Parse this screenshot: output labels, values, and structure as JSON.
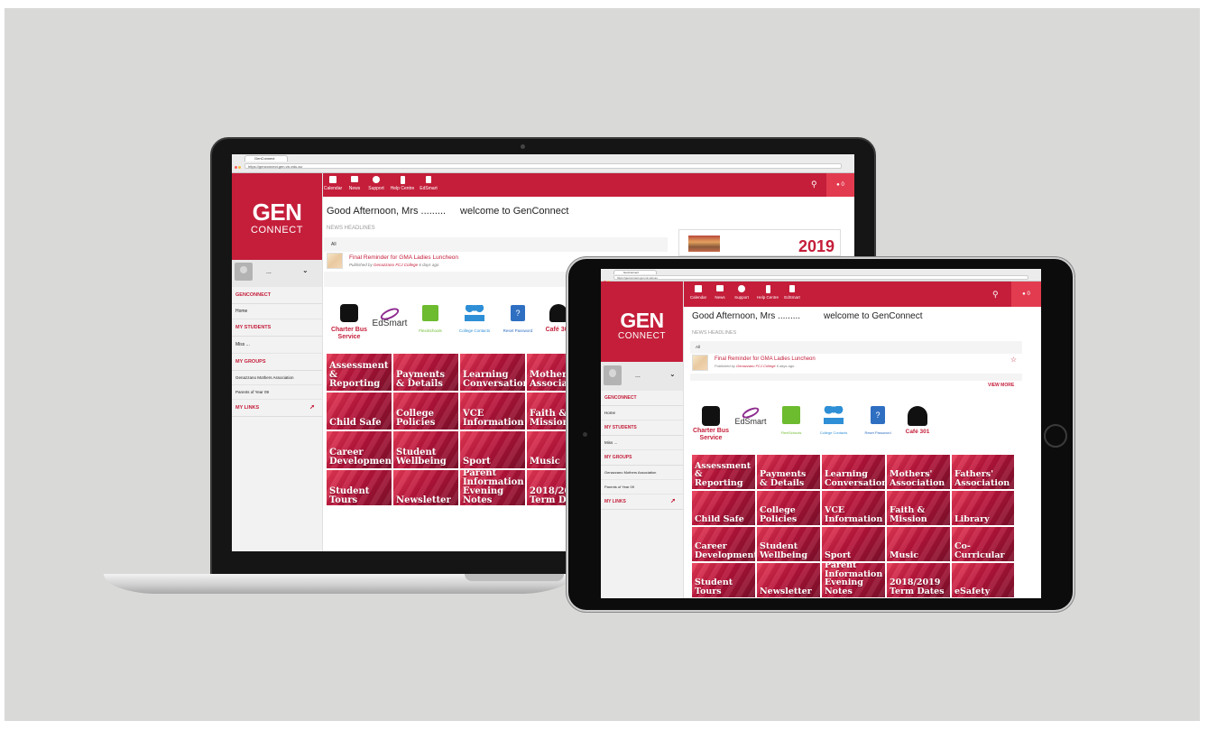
{
  "browser": {
    "tab_title": "GenConnect",
    "laptop_url": "https://genconnect.gen.vic.edu.au",
    "tablet_url": "https://genconnect.gen.vic.edu.au"
  },
  "topnav": {
    "items": [
      {
        "label": "Calendar",
        "icon": "calendar-icon"
      },
      {
        "label": "News",
        "icon": "news-icon"
      },
      {
        "label": "Support",
        "icon": "help-icon"
      },
      {
        "label": "Help Centre",
        "icon": "bookmark-icon"
      },
      {
        "label": "EdSmart",
        "icon": "document-icon"
      }
    ],
    "notifications": "0",
    "search_icon": "search-icon",
    "bell_icon": "bell-icon"
  },
  "brand": {
    "line1": "GEN",
    "line2": "CONNECT"
  },
  "user": {
    "name": "...",
    "chevron": "chevron-down-icon"
  },
  "sidebar": {
    "sections": [
      {
        "title": "GENCONNECT",
        "items": [
          "Home"
        ]
      },
      {
        "title": "MY STUDENTS",
        "items": [
          "Miss ..."
        ]
      },
      {
        "title": "MY GROUPS",
        "items": [
          "Genazzano Mothers Association",
          "Parents of Year 09"
        ]
      },
      {
        "title": "MY LINKS",
        "items": []
      }
    ]
  },
  "main": {
    "greeting": "Good Afternoon, Mrs .........",
    "welcome": "welcome to GenConnect",
    "news_heading": "NEWS HEADLINES",
    "news_filter": "All",
    "news": [
      {
        "title": "Final Reminder for GMA Ladies Luncheon",
        "published_prefix": "Published by",
        "publisher": "Genazzano FCJ College",
        "age": "6 days ago"
      }
    ],
    "view_more": "VIEW MORE",
    "ad_year": "2019"
  },
  "quick_links": [
    {
      "label": "Charter Bus Service",
      "icon": "bus-icon"
    },
    {
      "label": "EdSmart",
      "icon": "edsmart-logo"
    },
    {
      "label": "FlexiSchools",
      "icon": "flexischools-logo"
    },
    {
      "label": "College Contacts",
      "icon": "people-icon"
    },
    {
      "label": "Reset Password",
      "icon": "lock-icon"
    },
    {
      "label": "Café 301",
      "icon": "cafe-icon"
    }
  ],
  "tiles": [
    "Assessment\n& Reporting",
    "Payments\n& Details",
    "Learning\nConversations",
    "Mothers'\nAssociation",
    "Fathers'\nAssociation",
    "Child Safe",
    "College\nPolicies",
    "VCE\nInformation",
    "Faith &\nMission",
    "Library",
    "Career\nDevelopment",
    "Student\nWellbeing",
    "Sport",
    "Music",
    "Co-Curricular",
    "Student\nTours",
    "Newsletter",
    "Parent\nInformation\nEvening Notes",
    "2018/2019\nTerm Dates",
    "eSafety"
  ],
  "laptop_tile_labels": [
    "Assessment\n& Reporting",
    "Payments\n& Details",
    "Learning\nConversations",
    "Mothers'\nAssocia",
    "Child Safe",
    "College\nPolicies",
    "VCE\nInformation",
    "Faith &\nMission",
    "Career\nDevelopment",
    "Student\nWellbeing",
    "Sport",
    "Music",
    "Student\nTours",
    "Newsletter",
    "Parent\nInformation\nEvening Notes",
    "2018/2019\nTerm Dat"
  ],
  "colors": {
    "brand_red": "#c41e3a",
    "background": "#d9d9d7"
  }
}
